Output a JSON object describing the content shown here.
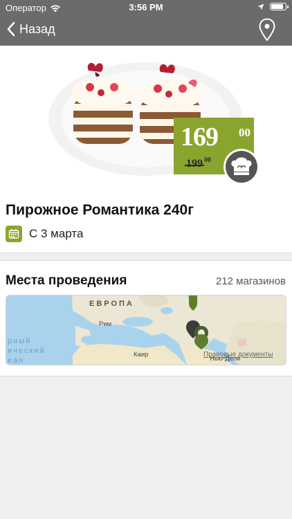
{
  "status_bar": {
    "carrier": "Оператор",
    "time": "3:56 PM",
    "battery_level": 0.9
  },
  "nav": {
    "back_label": "Назад",
    "back_icon": "chevron-left-icon",
    "map_icon": "map-pin-icon"
  },
  "product": {
    "title": "Пирожное Романтика 240г",
    "price_main": "169",
    "price_main_cents": "00",
    "price_old": "199",
    "price_old_cents": "00",
    "date_label": "С 3 марта",
    "colors": {
      "accent": "#8aa52d",
      "header": "#6b6b6b"
    }
  },
  "places": {
    "title": "Места проведения",
    "count": "212 магазинов"
  },
  "map": {
    "region": "ЕВРОПА",
    "city_rome": "Рим",
    "city_cairo": "Каир",
    "city_delhi": "Нью-Дели",
    "legal": "Правовые документы",
    "water_1": "рный",
    "water_2": "ический",
    "water_3": "еан"
  }
}
